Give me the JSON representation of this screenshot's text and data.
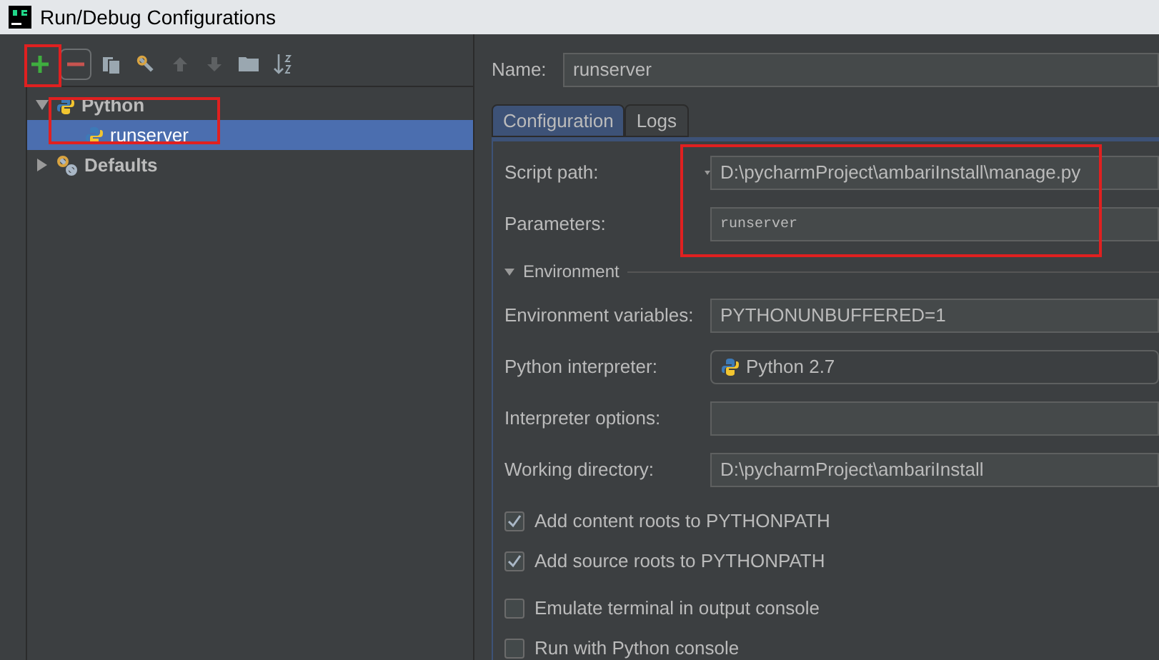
{
  "window": {
    "title": "Run/Debug Configurations"
  },
  "toolbar": [
    {
      "kind": "add",
      "disabled": false
    },
    {
      "kind": "remove",
      "disabled": false
    },
    {
      "kind": "copy",
      "disabled": false
    },
    {
      "kind": "wrench",
      "disabled": false
    },
    {
      "kind": "up",
      "disabled": true
    },
    {
      "kind": "down",
      "disabled": true
    },
    {
      "kind": "folder",
      "disabled": false
    },
    {
      "kind": "sort",
      "disabled": false
    }
  ],
  "tree": [
    {
      "label": "Python",
      "expanded": true,
      "selected": false,
      "children": [
        {
          "label": "runserver",
          "selected": true
        }
      ]
    },
    {
      "label": "Defaults",
      "expanded": false,
      "selected": false
    }
  ],
  "name_field": {
    "label": "Name:",
    "value": "runserver"
  },
  "tabs": [
    {
      "label": "Configuration",
      "selected": true
    },
    {
      "label": "Logs",
      "selected": false
    }
  ],
  "script_fields": [
    {
      "label": "Script path:",
      "value": "D:\\pycharmProject\\ambariInstall\\manage.py",
      "kind": "dropdown-label"
    },
    {
      "label": "Parameters:",
      "value": "runserver",
      "kind": "mono"
    }
  ],
  "environment": {
    "title": "Environment",
    "expanded": true
  },
  "fields": [
    {
      "label": "Environment variables:",
      "value": "PYTHONUNBUFFERED=1",
      "kind": "text"
    },
    {
      "label": "Python interpreter:",
      "value": "Python 2.7",
      "kind": "interpreter"
    },
    {
      "label": "Interpreter options:",
      "kind": "text"
    },
    {
      "label": "Working directory:",
      "value": "D:\\pycharmProject\\ambariInstall",
      "kind": "text"
    }
  ],
  "checkboxes": [
    {
      "label": "Add content roots to PYTHONPATH",
      "checked": true
    },
    {
      "label": "Add source roots to PYTHONPATH",
      "checked": true
    },
    {
      "label": "Emulate terminal in output console",
      "checked": false
    },
    {
      "label": "Run with Python console",
      "checked": false
    }
  ]
}
